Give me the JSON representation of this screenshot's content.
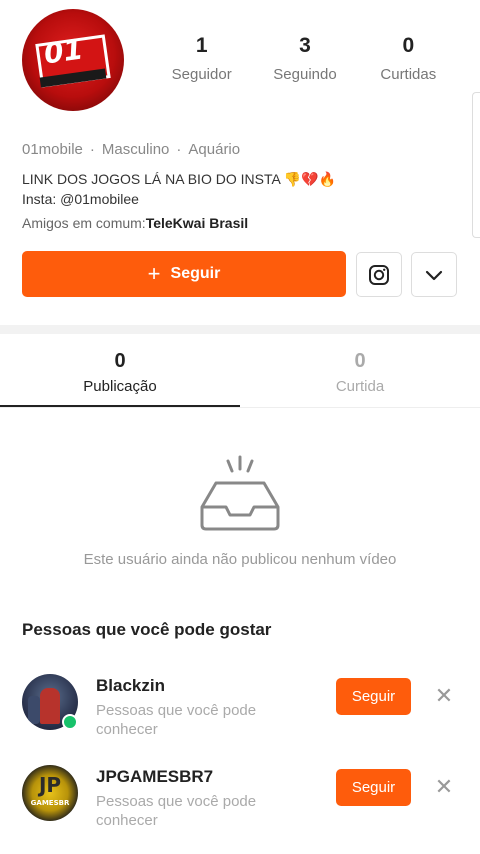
{
  "profile": {
    "avatar_icon": "profile-logo-01-icon",
    "avatar_logo_text": "01",
    "stats": [
      {
        "value": "1",
        "label": "Seguidor"
      },
      {
        "value": "3",
        "label": "Seguindo"
      },
      {
        "value": "0",
        "label": "Curtidas"
      }
    ],
    "meta": {
      "username": "01mobile",
      "gender": "Masculino",
      "sign": "Aquário"
    },
    "bio_line1": "LINK DOS JOGOS LÁ NA BIO DO INSTA",
    "bio_emojis": "👎💔🔥",
    "bio_line2": "Insta: @01mobilee",
    "friends_prefix": "Amigos em comum:",
    "friends_name": "TeleKwai Brasil",
    "follow_label": "Seguir",
    "follow_plus": "+",
    "instagram_icon": "instagram-icon",
    "more_icon": "chevron-down-icon"
  },
  "tabs": [
    {
      "count": "0",
      "label": "Publicação",
      "active": true
    },
    {
      "count": "0",
      "label": "Curtida",
      "active": false
    }
  ],
  "empty_state": {
    "icon": "empty-inbox-icon",
    "text": "Este usuário ainda não publicou nenhum vídeo"
  },
  "suggestions": {
    "title": "Pessoas que você pode gostar",
    "items": [
      {
        "name": "Blackzin",
        "desc": "Pessoas que você pode conhecer",
        "follow_label": "Seguir",
        "close": "✕",
        "online": true
      },
      {
        "name": "JPGAMESBR7",
        "desc": "Pessoas que você pode conhecer",
        "follow_label": "Seguir",
        "close": "✕",
        "online": false,
        "avatar_text": "JP",
        "avatar_subtext": "GAMESBR"
      }
    ]
  },
  "colors": {
    "accent": "#fe5c0c",
    "online": "#17c26b"
  }
}
